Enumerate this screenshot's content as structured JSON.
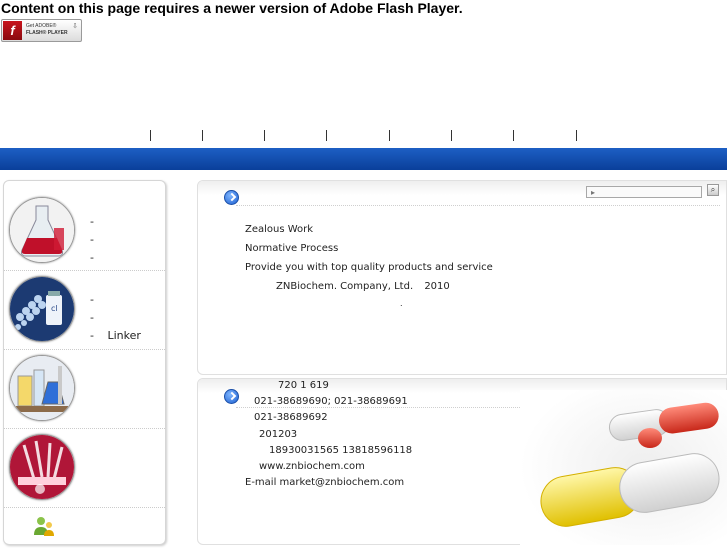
{
  "flash": {
    "message": "Content on this page requires a newer version of Adobe Flash Player.",
    "badge_line1": "Get ADOBE®",
    "badge_line2": "FLASH® PLAYER",
    "badge_logo": "f"
  },
  "nav": {
    "separators": [
      "|",
      "|",
      "|",
      "|",
      "|",
      "|",
      "|",
      "|"
    ]
  },
  "sidebar": {
    "sections": [
      {
        "image": "red-flask-beaker",
        "items": [
          "-",
          "-",
          "-"
        ]
      },
      {
        "image": "peptide-molecule-vial",
        "items": [
          "-",
          "-",
          "-"
        ],
        "third_item_label": "Linker"
      },
      {
        "image": "chemistry-glassware",
        "items": []
      },
      {
        "image": "test-tubes-rack",
        "items": []
      }
    ],
    "bottom_icon": "people-icon"
  },
  "about": {
    "line1": "Zealous Work",
    "line2": "Normative Process",
    "line3": "Provide you with top quality products and service",
    "company": "ZNBiochem. Company, Ltd.",
    "year": "2010",
    "dot": "."
  },
  "search": {
    "placeholder": "▸",
    "button_icon": "magnifier-icon"
  },
  "contact": {
    "address": "720 1  619",
    "phone": "021-38689690;  021-38689691",
    "fax": "021-38689692",
    "postcode": "201203",
    "mobile": "18930031565 13818596118",
    "website": "www.znbiochem.com",
    "email": "E-mail market@znbiochem.com"
  },
  "colors": {
    "bar_blue": "#0a47a6",
    "flash_red": "#b3121a",
    "icon_blue": "#1c5fd0"
  }
}
